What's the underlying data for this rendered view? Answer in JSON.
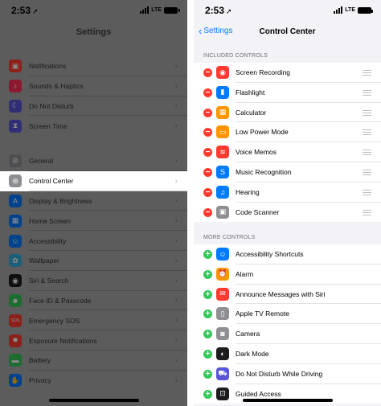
{
  "left_pane": {
    "status": {
      "time": "2:53",
      "network": "LTE"
    },
    "title": "Settings",
    "group1": [
      {
        "label": "Notifications",
        "icon": "bell-icon",
        "color": "#ff3b30",
        "glyph": "▣"
      },
      {
        "label": "Sounds & Haptics",
        "icon": "speaker-icon",
        "color": "#ff2d55",
        "glyph": "♪"
      },
      {
        "label": "Do Not Disturb",
        "icon": "moon-icon",
        "color": "#5856d6",
        "glyph": "☾"
      },
      {
        "label": "Screen Time",
        "icon": "hourglass-icon",
        "color": "#5856d6",
        "glyph": "⧗"
      }
    ],
    "group2": [
      {
        "label": "General",
        "icon": "gear-icon",
        "color": "#8e8e93",
        "glyph": "⚙"
      },
      {
        "label": "Control Center",
        "icon": "toggles-icon",
        "color": "#8e8e93",
        "glyph": "⊜"
      },
      {
        "label": "Display & Brightness",
        "icon": "aa-icon",
        "color": "#007aff",
        "glyph": "A"
      },
      {
        "label": "Home Screen",
        "icon": "grid-icon",
        "color": "#007aff",
        "glyph": "▦"
      },
      {
        "label": "Accessibility",
        "icon": "accessibility-icon",
        "color": "#007aff",
        "glyph": "☺"
      },
      {
        "label": "Wallpaper",
        "icon": "flower-icon",
        "color": "#34aadc",
        "glyph": "✿"
      },
      {
        "label": "Siri & Search",
        "icon": "siri-icon",
        "color": "#1c1c1e",
        "glyph": "◉"
      },
      {
        "label": "Face ID & Passcode",
        "icon": "face-id-icon",
        "color": "#34c759",
        "glyph": "☻"
      },
      {
        "label": "Emergency SOS",
        "icon": "sos-icon",
        "color": "#ff3b30",
        "glyph": "SOS"
      },
      {
        "label": "Exposure Notifications",
        "icon": "virus-icon",
        "color": "#ff3b30",
        "glyph": "✹"
      },
      {
        "label": "Battery",
        "icon": "battery-icon",
        "color": "#34c759",
        "glyph": "▬"
      },
      {
        "label": "Privacy",
        "icon": "hand-icon",
        "color": "#007aff",
        "glyph": "✋"
      }
    ],
    "selected": "Control Center"
  },
  "right_pane": {
    "status": {
      "time": "2:53",
      "network": "LTE"
    },
    "back_label": "Settings",
    "title": "Control Center",
    "included_header": "INCLUDED CONTROLS",
    "more_header": "MORE CONTROLS",
    "included": [
      {
        "label": "Screen Recording",
        "icon": "record-icon",
        "color": "#ff3b30",
        "glyph": "◉"
      },
      {
        "label": "Flashlight",
        "icon": "flashlight-icon",
        "color": "#007aff",
        "glyph": "▮"
      },
      {
        "label": "Calculator",
        "icon": "calculator-icon",
        "color": "#ff9500",
        "glyph": "▦"
      },
      {
        "label": "Low Power Mode",
        "icon": "battery-icon",
        "color": "#ff9500",
        "glyph": "▭"
      },
      {
        "label": "Voice Memos",
        "icon": "waveform-icon",
        "color": "#ff3b30",
        "glyph": "≋"
      },
      {
        "label": "Music Recognition",
        "icon": "shazam-icon",
        "color": "#007aff",
        "glyph": "S"
      },
      {
        "label": "Hearing",
        "icon": "ear-icon",
        "color": "#007aff",
        "glyph": "♫"
      },
      {
        "label": "Code Scanner",
        "icon": "qr-scanner-icon",
        "color": "#8e8e93",
        "glyph": "▣"
      }
    ],
    "more": [
      {
        "label": "Accessibility Shortcuts",
        "icon": "accessibility-icon",
        "color": "#007aff",
        "glyph": "☺"
      },
      {
        "label": "Alarm",
        "icon": "alarm-icon",
        "color": "#ff9500",
        "glyph": "⏰"
      },
      {
        "label": "Announce Messages with Siri",
        "icon": "announce-icon",
        "color": "#ff3b30",
        "glyph": "✉"
      },
      {
        "label": "Apple TV Remote",
        "icon": "remote-icon",
        "color": "#8e8e93",
        "glyph": "▯"
      },
      {
        "label": "Camera",
        "icon": "camera-icon",
        "color": "#8e8e93",
        "glyph": "◙"
      },
      {
        "label": "Dark Mode",
        "icon": "dark-mode-icon",
        "color": "#1c1c1e",
        "glyph": "◐"
      },
      {
        "label": "Do Not Disturb While Driving",
        "icon": "car-icon",
        "color": "#5856d6",
        "glyph": "⛟"
      },
      {
        "label": "Guided Access",
        "icon": "lock-icon",
        "color": "#1c1c1e",
        "glyph": "⊡"
      }
    ]
  }
}
